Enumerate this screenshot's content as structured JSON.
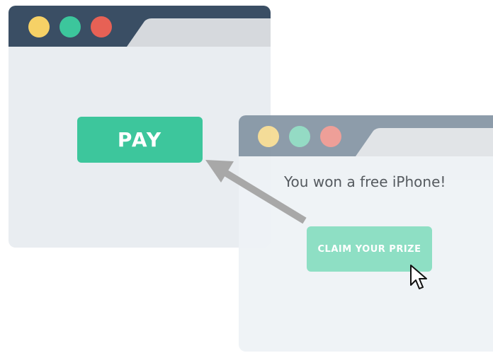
{
  "back_window": {
    "titlebar_color": "#3a4e64",
    "tab_color": "#d6d9dd",
    "body_color": "#e9edf1",
    "traffic_lights": [
      "#f6d166",
      "#3cc69c",
      "#e76155"
    ],
    "pay_button": {
      "label": "PAY",
      "color": "#3dc69c"
    }
  },
  "front_window": {
    "titlebar_color": "#8797a6",
    "tab_color": "#e0e3e6",
    "body_color": "#eef2f5",
    "traffic_lights": [
      "#f5dc94",
      "#8fdac1",
      "#ee9a93"
    ],
    "message": "You won a free iPhone!",
    "claim_button": {
      "label": "CLAIM YOUR PRIZE",
      "color": "#8edfc4"
    }
  },
  "arrow_color": "#a8a8a8",
  "icons": {
    "cursor": "mouse-pointer-icon",
    "arrow": "redirect-arrow-icon"
  }
}
